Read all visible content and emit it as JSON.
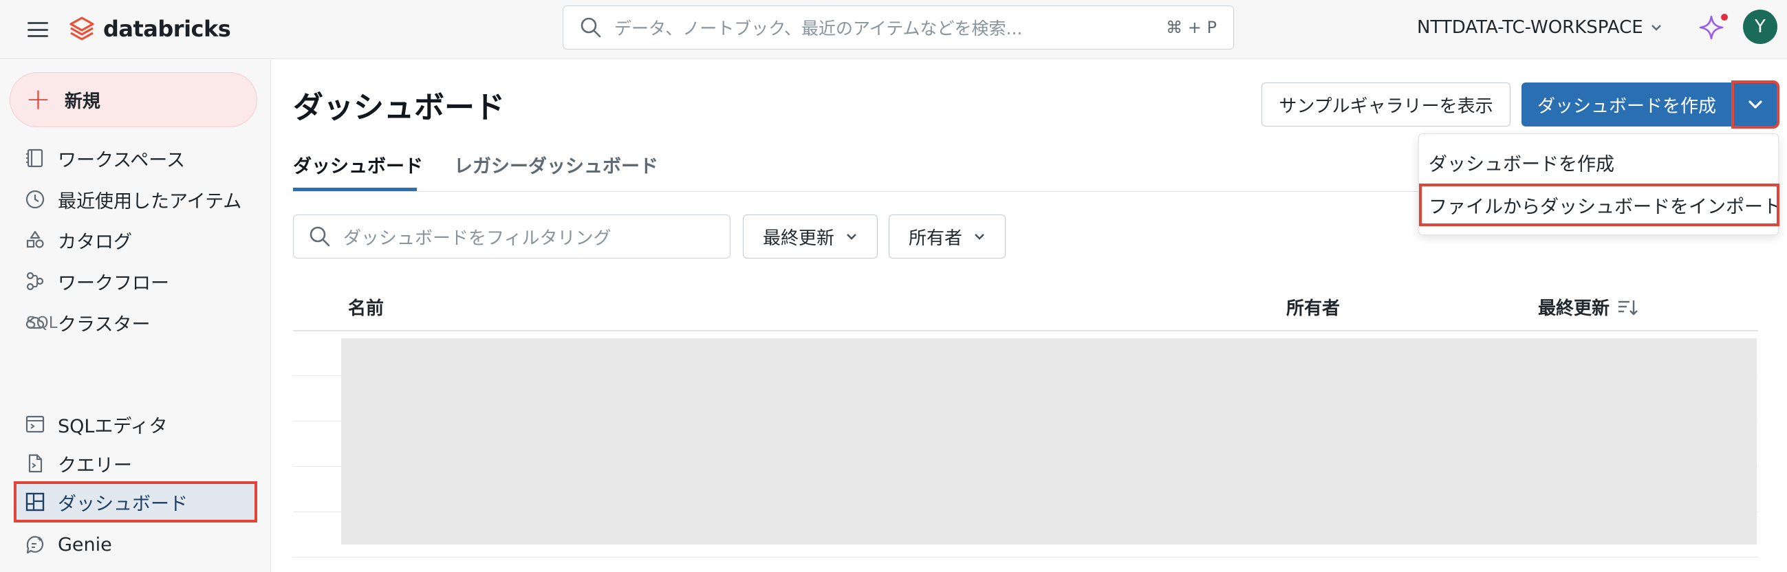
{
  "header": {
    "logo_text": "databricks",
    "search_placeholder": "データ、ノートブック、最近のアイテムなどを検索...",
    "search_shortcut": "⌘ + P",
    "workspace_name": "NTTDATA-TC-WORKSPACE",
    "avatar_initial": "Y"
  },
  "sidebar": {
    "new_label": "新規",
    "items": [
      {
        "label": "ワークスペース"
      },
      {
        "label": "最近使用したアイテム"
      },
      {
        "label": "カタログ"
      },
      {
        "label": "ワークフロー"
      },
      {
        "label": "クラスター"
      }
    ],
    "sql_section_label": "SQL",
    "sql_items": [
      {
        "label": "SQLエディタ"
      },
      {
        "label": "クエリー"
      },
      {
        "label": "ダッシュボード"
      },
      {
        "label": "Genie"
      }
    ]
  },
  "main": {
    "title": "ダッシュボード",
    "gallery_button": "サンプルギャラリーを表示",
    "create_button": "ダッシュボードを作成",
    "tabs": [
      {
        "label": "ダッシュボード",
        "selected": true
      },
      {
        "label": "レガシーダッシュボード",
        "selected": false
      }
    ],
    "filter_placeholder": "ダッシュボードをフィルタリング",
    "sort_dropdown": "最終更新",
    "owner_dropdown": "所有者",
    "table": {
      "columns": [
        "名前",
        "所有者",
        "最終更新"
      ]
    }
  },
  "create_menu": {
    "items": [
      {
        "label": "ダッシュボードを作成"
      },
      {
        "label": "ファイルからダッシュボードをインポート"
      }
    ]
  },
  "colors": {
    "primary": "#2b6fb3",
    "highlight": "#e0453a",
    "new_button_bg": "#fbe8e8"
  }
}
